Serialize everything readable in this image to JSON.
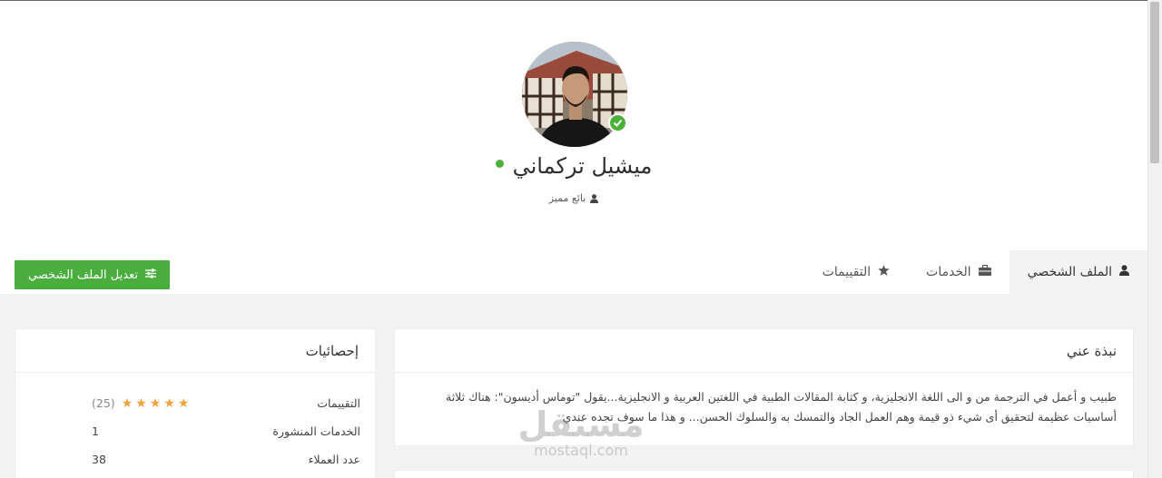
{
  "profile": {
    "name": "ميشيل تركماني",
    "role": "بائع مميز",
    "online": true,
    "verified": true
  },
  "tabs": [
    {
      "label": "الملف الشخصي",
      "icon": "user-icon",
      "active": true
    },
    {
      "label": "الخدمات",
      "icon": "briefcase-icon",
      "active": false
    },
    {
      "label": "التقييمات",
      "icon": "star-icon",
      "active": false
    }
  ],
  "edit_button": {
    "label": "تعديل الملف الشخصي",
    "icon": "sliders-icon"
  },
  "about": {
    "title": "نبذة عني",
    "text": "طبيب و أعمل في الترجمة من و الى اللغة الانجليزية، و كتابة المقالات الطبية في اللغتين العربية و الانجليزية...يقول \"توماس أديسون\": هناك ثلاثة أساسيات عظيمة لتحقيق أى شيء ذو قيمة وهم العمل الجاد والتمسك به والسلوك الحسن... و هذا ما سوف تجده عندي"
  },
  "stats": {
    "title": "إحصائيات",
    "rows": [
      {
        "label": "التقييمات",
        "stars": 5,
        "count": "(25)"
      },
      {
        "label": "الخدمات المنشورة",
        "value": "1"
      },
      {
        "label": "عدد العملاء",
        "value": "38"
      }
    ]
  },
  "watermark": {
    "arabic": "مستقل",
    "latin": "mostaql.com"
  },
  "colors": {
    "accent": "#4aae3f",
    "star": "#f0a33a",
    "background": "#f3f3f3"
  }
}
